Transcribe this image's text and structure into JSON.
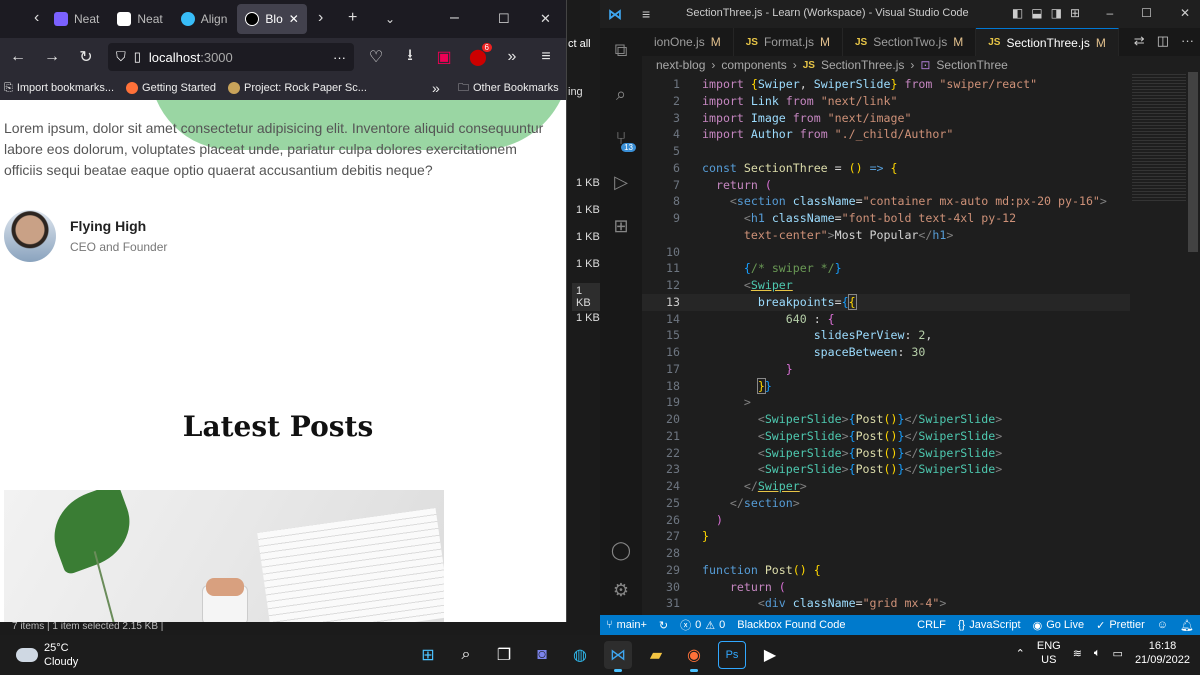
{
  "explorer": {
    "select_all": "ct all",
    "nav_text": "ing",
    "sizes": [
      "1 KB",
      "1 KB",
      "1 KB",
      "1 KB",
      "1 KB",
      "1 KB"
    ],
    "status": "7 items  |  1 item selected  2.15 KB  |"
  },
  "firefox": {
    "tabs": [
      {
        "label": "Neat",
        "active": false
      },
      {
        "label": "Neat",
        "active": false
      },
      {
        "label": "Align",
        "active": false
      },
      {
        "label": "Blo",
        "active": true
      }
    ],
    "url_host": "localhost",
    "url_port": ":3000",
    "notification_count": "6",
    "bookmarks": [
      {
        "label": "Import bookmarks..."
      },
      {
        "label": "Getting Started"
      },
      {
        "label": "Project: Rock Paper Sc..."
      }
    ],
    "other_bookmarks": "Other Bookmarks",
    "page": {
      "lorem": "Lorem ipsum, dolor sit amet consectetur adipisicing elit. Inventore aliquid consequuntur labore eos dolorum, voluptates placeat unde, pariatur culpa dolores exercitationem officiis sequi beatae eaque optio quaerat accusantium debitis neque?",
      "author_name": "Flying High",
      "author_role": "CEO and Founder",
      "latest_posts": "Latest Posts"
    }
  },
  "vscode": {
    "title": "SectionThree.js - Learn (Workspace) - Visual Studio Code",
    "tabs": [
      {
        "label": "ionOne.js",
        "mark": "M",
        "active": false
      },
      {
        "label": "Format.js",
        "mark": "M",
        "active": false
      },
      {
        "label": "SectionTwo.js",
        "mark": "M",
        "active": false
      },
      {
        "label": "SectionThree.js",
        "mark": "M",
        "active": true
      }
    ],
    "breadcrumb": [
      "next-blog",
      "components",
      "SectionThree.js",
      "SectionThree"
    ],
    "source_control_badge": "13",
    "current_line": 13,
    "status": {
      "branch": "main+",
      "errors": "0",
      "warnings": "0",
      "blackbox": "Blackbox Found Code",
      "eol": "CRLF",
      "language": "JavaScript",
      "golive": "Go Live",
      "prettier": "Prettier"
    }
  },
  "taskbar": {
    "temp": "25°C",
    "condition": "Cloudy",
    "lang1": "ENG",
    "lang2": "US",
    "time": "16:18",
    "date": "21/09/2022"
  },
  "colors": {
    "accent": "#007acc",
    "blob": "#9ad6a3"
  }
}
